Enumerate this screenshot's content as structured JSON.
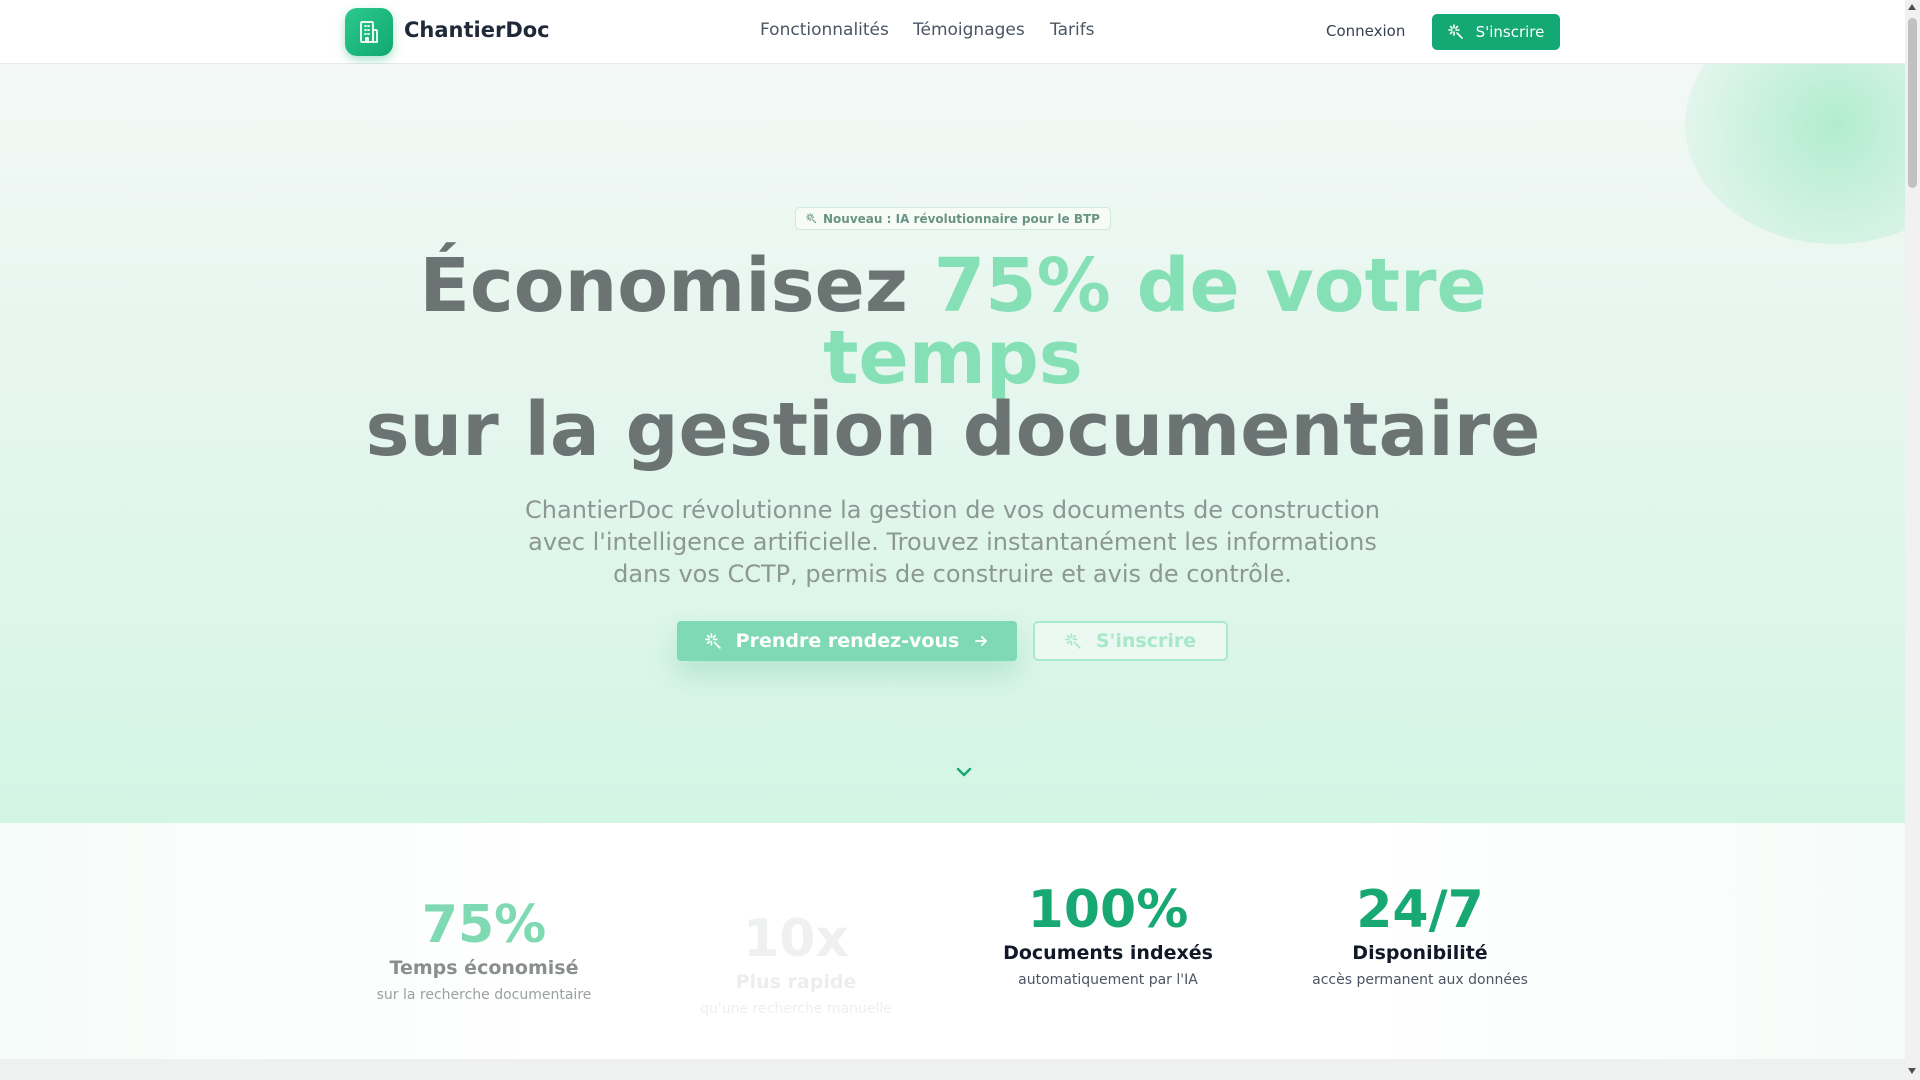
{
  "header": {
    "brand": "ChantierDoc",
    "nav": [
      "Fonctionnalités",
      "Témoignages",
      "Tarifs"
    ],
    "login": "Connexion",
    "signup": "S'inscrire"
  },
  "hero": {
    "badge": "Nouveau : IA révolutionnaire pour le BTP",
    "headline_part1": "Économisez ",
    "headline_accent": "75% de votre temps",
    "headline_part2": "sur la gestion documentaire",
    "subtext": "ChantierDoc révolutionne la gestion de vos documents de construction avec l'intelligence artificielle. Trouvez instantanément les informations dans vos CCTP, permis de construire et avis de contrôle.",
    "cta_primary": "Prendre rendez-vous",
    "cta_secondary": "S'inscrire"
  },
  "stats": [
    {
      "value": "75%",
      "label": "Temps économisé",
      "sub": "sur la recherche documentaire"
    },
    {
      "value": "10x",
      "label": "Plus rapide",
      "sub": "qu'une recherche manuelle"
    },
    {
      "value": "100%",
      "label": "Documents indexés",
      "sub": "automatiquement par l'IA"
    },
    {
      "value": "24/7",
      "label": "Disponibilité",
      "sub": "accès permanent aux données"
    }
  ],
  "colors": {
    "brand_green": "#13a874",
    "accent_light": "#86e0b6"
  },
  "icons": {
    "logo": "building-icon",
    "sparkle": "sparkle-icon",
    "arrow": "arrow-right-icon",
    "scroll": "chevron-down-icon"
  }
}
